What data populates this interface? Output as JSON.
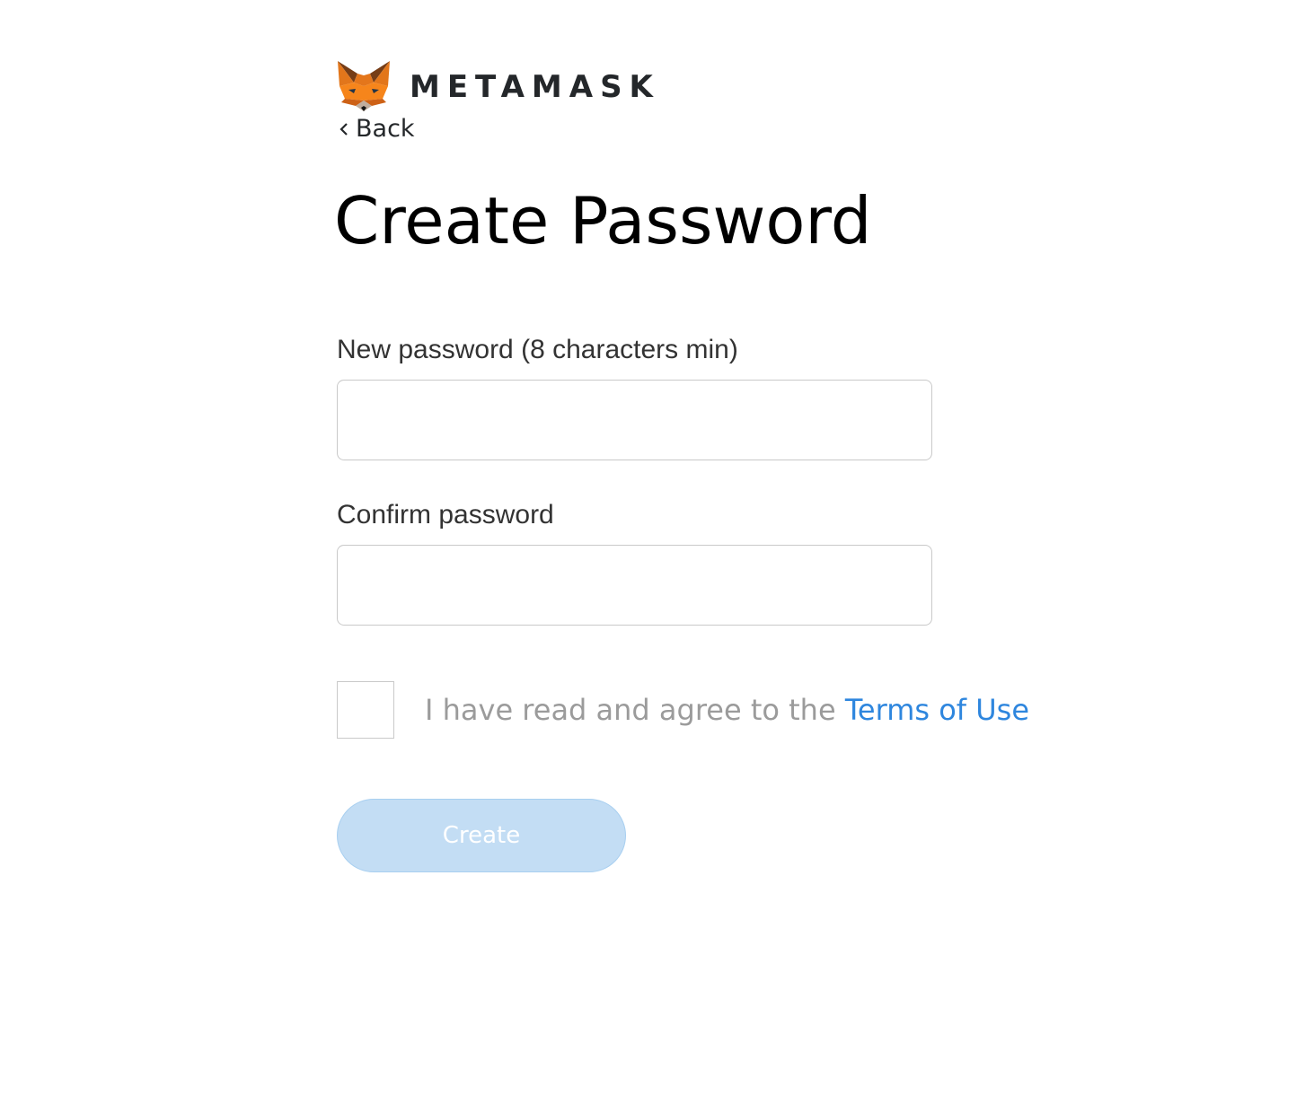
{
  "brand": {
    "name": "METAMASK",
    "logo_icon": "metamask-fox-icon",
    "fox_colors": [
      "#e2761b",
      "#f6851b",
      "#763d16",
      "#cd6116",
      "#e4761b",
      "#233447",
      "#c0ad9e"
    ]
  },
  "nav": {
    "back_label": "Back",
    "back_icon": "chevron-left-icon"
  },
  "page": {
    "title": "Create Password"
  },
  "form": {
    "new_password": {
      "label": "New password (8 characters min)",
      "value": "",
      "placeholder": ""
    },
    "confirm_password": {
      "label": "Confirm password",
      "value": "",
      "placeholder": ""
    },
    "terms": {
      "checked": false,
      "text": "I have read and agree to the ",
      "link_text": "Terms of Use"
    },
    "create_button": {
      "label": "Create",
      "enabled": false
    }
  },
  "colors": {
    "link": "#2e86de",
    "button_disabled_bg": "#c3ddf4",
    "input_border": "#c9c9c9",
    "muted_text": "#9b9b9b"
  }
}
